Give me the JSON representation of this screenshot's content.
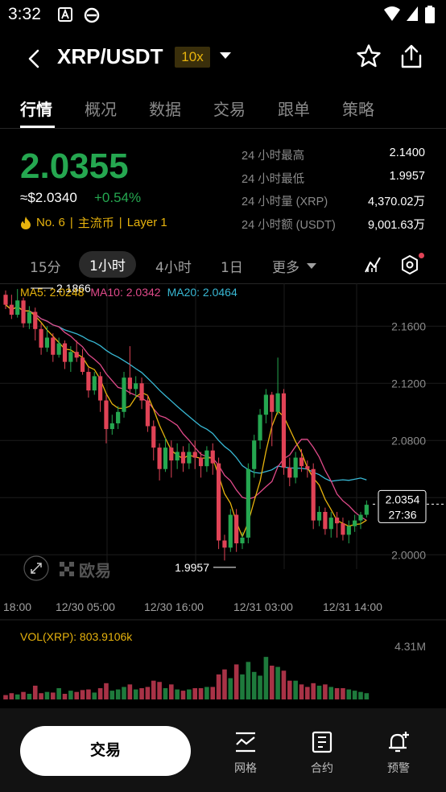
{
  "status": {
    "time": "3:32"
  },
  "header": {
    "pair": "XRP/USDT",
    "leverage": "10x"
  },
  "tabs": [
    "行情",
    "概况",
    "数据",
    "交易",
    "跟单",
    "策略"
  ],
  "ticker": {
    "price": "2.0355",
    "usd": "≈$2.0340",
    "change": "+0.54%",
    "rank": "No. 6",
    "tag1": "主流币",
    "tag2": "Layer 1",
    "sep": "|"
  },
  "stats": [
    {
      "label": "24 小时最高",
      "value": "2.1400"
    },
    {
      "label": "24 小时最低",
      "value": "1.9957"
    },
    {
      "label": "24 小时量 (XRP)",
      "value": "4,370.02万"
    },
    {
      "label": "24 小时额 (USDT)",
      "value": "9,001.63万"
    }
  ],
  "timeframes": [
    "15分",
    "1小时",
    "4小时",
    "1日",
    "更多"
  ],
  "ma": {
    "ma5": "MA5: 2.0248",
    "ma10": "MA10: 2.0342",
    "ma20": "MA20: 2.0464"
  },
  "colors": {
    "up": "#25a750",
    "down": "#e04356",
    "ma5": "#e7b30d",
    "ma10": "#e04a8a",
    "ma20": "#38b8d4",
    "accent": "#e7b30d"
  },
  "chart_data": {
    "type": "candlestick",
    "y_ticks": [
      "2.1600",
      "2.1200",
      "2.0800",
      "2.0400",
      "2.0000"
    ],
    "ylim": [
      1.99,
      2.19
    ],
    "x_ticks": [
      "18:00",
      "12/30 05:00",
      "12/30 16:00",
      "12/31 03:00",
      "12/31 14:00"
    ],
    "high_label": "2.1866",
    "low_label": "1.9957",
    "current_price": "2.0354",
    "countdown": "27:36",
    "watermark": "欧易",
    "candles": [
      [
        2.182,
        2.175,
        2.185,
        2.172
      ],
      [
        2.175,
        2.168,
        2.182,
        2.165
      ],
      [
        2.168,
        2.178,
        2.186,
        2.166
      ],
      [
        2.178,
        2.162,
        2.18,
        2.159
      ],
      [
        2.162,
        2.17,
        2.174,
        2.158
      ],
      [
        2.17,
        2.158,
        2.173,
        2.15
      ],
      [
        2.158,
        2.145,
        2.162,
        2.14
      ],
      [
        2.145,
        2.152,
        2.16,
        2.142
      ],
      [
        2.152,
        2.14,
        2.155,
        2.135
      ],
      [
        2.14,
        2.148,
        2.152,
        2.138
      ],
      [
        2.148,
        2.135,
        2.15,
        2.13
      ],
      [
        2.135,
        2.142,
        2.146,
        2.128
      ],
      [
        2.142,
        2.138,
        2.15,
        2.135
      ],
      [
        2.138,
        2.128,
        2.144,
        2.126
      ],
      [
        2.128,
        2.115,
        2.131,
        2.11
      ],
      [
        2.115,
        2.125,
        2.128,
        2.112
      ],
      [
        2.125,
        2.108,
        2.128,
        2.1
      ],
      [
        2.108,
        2.088,
        2.112,
        2.078
      ],
      [
        2.088,
        2.092,
        2.098,
        2.084
      ],
      [
        2.092,
        2.1,
        2.104,
        2.088
      ],
      [
        2.1,
        2.124,
        2.128,
        2.096
      ],
      [
        2.124,
        2.116,
        2.146,
        2.112
      ],
      [
        2.116,
        2.12,
        2.125,
        2.11
      ],
      [
        2.12,
        2.108,
        2.124,
        2.102
      ],
      [
        2.108,
        2.09,
        2.112,
        2.086
      ],
      [
        2.09,
        2.075,
        2.094,
        2.066
      ],
      [
        2.075,
        2.06,
        2.078,
        2.052
      ],
      [
        2.06,
        2.075,
        2.082,
        2.058
      ],
      [
        2.075,
        2.066,
        2.08,
        2.054
      ],
      [
        2.066,
        2.072,
        2.078,
        2.06
      ],
      [
        2.072,
        2.064,
        2.076,
        2.058
      ],
      [
        2.064,
        2.072,
        2.078,
        2.06
      ],
      [
        2.072,
        2.068,
        2.08,
        2.06
      ],
      [
        2.068,
        2.062,
        2.072,
        2.054
      ],
      [
        2.062,
        2.073,
        2.076,
        2.058
      ],
      [
        2.073,
        2.064,
        2.078,
        2.056
      ],
      [
        2.064,
        2.01,
        2.068,
        2.004
      ],
      [
        2.01,
        2.005,
        2.014,
        1.996
      ],
      [
        2.005,
        2.028,
        2.032,
        2.002
      ],
      [
        2.028,
        2.008,
        2.032,
        2.002
      ],
      [
        2.008,
        2.012,
        2.016,
        2.004
      ],
      [
        2.012,
        2.06,
        2.064,
        2.008
      ],
      [
        2.06,
        2.08,
        2.084,
        2.054
      ],
      [
        2.08,
        2.098,
        2.102,
        2.074
      ],
      [
        2.098,
        2.112,
        2.116,
        2.092
      ],
      [
        2.112,
        2.1,
        2.114,
        2.076
      ],
      [
        2.1,
        2.113,
        2.138,
        2.098
      ],
      [
        2.113,
        2.061,
        2.116,
        2.056
      ],
      [
        2.061,
        2.054,
        2.068,
        2.048
      ],
      [
        2.054,
        2.068,
        2.072,
        2.05
      ],
      [
        2.068,
        2.062,
        2.074,
        2.058
      ],
      [
        2.062,
        2.06,
        2.066,
        2.054
      ],
      [
        2.06,
        2.024,
        2.064,
        2.018
      ],
      [
        2.024,
        2.03,
        2.034,
        2.02
      ],
      [
        2.03,
        2.018,
        2.033,
        2.014
      ],
      [
        2.018,
        2.026,
        2.03,
        2.012
      ],
      [
        2.026,
        2.022,
        2.03,
        2.012
      ],
      [
        2.022,
        2.014,
        2.026,
        2.01
      ],
      [
        2.014,
        2.02,
        2.024,
        2.008
      ],
      [
        2.02,
        2.024,
        2.028,
        2.016
      ],
      [
        2.024,
        2.028,
        2.03,
        2.018
      ],
      [
        2.028,
        2.035,
        2.038,
        2.026
      ]
    ],
    "volume": {
      "label": "VOL(XRP): 803.9106k",
      "max_label": "4.31M",
      "max": 4.31,
      "values": [
        0.35,
        0.5,
        0.4,
        0.6,
        0.45,
        1.1,
        0.5,
        0.6,
        0.55,
        0.9,
        0.45,
        0.7,
        0.6,
        0.75,
        0.8,
        0.55,
        0.9,
        1.3,
        0.7,
        0.8,
        1.0,
        1.2,
        0.8,
        0.9,
        1.0,
        1.5,
        1.4,
        0.9,
        1.2,
        0.8,
        0.7,
        0.8,
        0.9,
        0.9,
        1.0,
        1.0,
        2.0,
        2.4,
        1.7,
        2.8,
        2.0,
        3.0,
        2.2,
        1.9,
        3.4,
        2.7,
        2.6,
        2.3,
        1.5,
        1.5,
        1.2,
        1.0,
        1.3,
        1.1,
        1.2,
        1.0,
        0.9,
        0.9,
        0.8,
        0.7,
        0.6,
        0.5
      ]
    }
  },
  "bottom": {
    "trade": "交易",
    "nav": [
      {
        "label": "网格"
      },
      {
        "label": "合约"
      },
      {
        "label": "预警"
      }
    ]
  }
}
